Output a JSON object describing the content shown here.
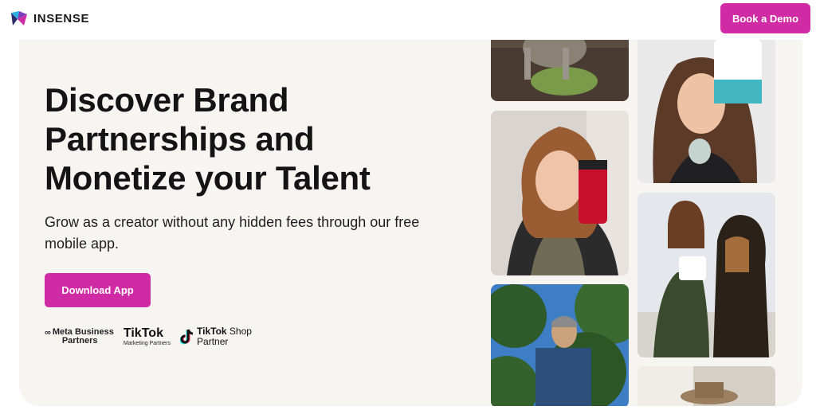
{
  "header": {
    "logo_text": "INSENSE",
    "book_demo_label": "Book a Demo"
  },
  "hero": {
    "headline_line1": "Discover Brand",
    "headline_line2": "Partnerships and",
    "headline_line3": "Monetize your Talent",
    "subtext": "Grow as a creator without any hidden fees through our free mobile app.",
    "download_label": "Download App"
  },
  "partners": {
    "meta_line1": "Meta Business",
    "meta_line2": "Partners",
    "tiktok_name": "TikTok",
    "tiktok_sub": "Marketing Partners",
    "tiktok_shop_line1_bold": "TikTok",
    "tiktok_shop_line1_rest": " Shop",
    "tiktok_shop_line2": "Partner"
  },
  "colors": {
    "brand": "#d02aa4",
    "hero_bg": "#f7f5f2",
    "text": "#141414"
  },
  "icons": [
    "insense-logo-icon",
    "meta-icon",
    "tiktok-icon"
  ]
}
